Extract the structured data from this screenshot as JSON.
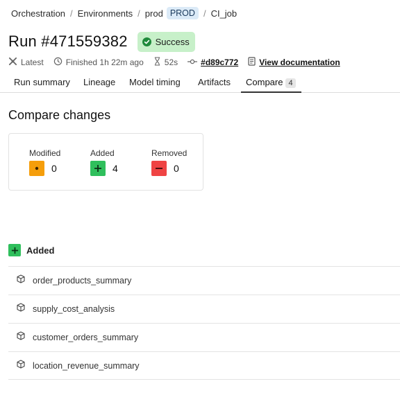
{
  "breadcrumb": {
    "items": [
      "Orchestration",
      "Environments",
      "prod"
    ],
    "env_badge": "PROD",
    "job": "CI_job",
    "separator": "/"
  },
  "header": {
    "title": "Run #471559382",
    "status": "Success",
    "status_color": "#c7f0c9"
  },
  "meta": {
    "latest": "Latest",
    "finished": "Finished 1h 22m ago",
    "duration": "52s",
    "commit": "#d89c772",
    "docs": "View documentation"
  },
  "tabs": [
    {
      "label": "Run summary"
    },
    {
      "label": "Lineage"
    },
    {
      "label": "Model timing"
    },
    {
      "label": "Artifacts"
    },
    {
      "label": "Compare",
      "count": "4",
      "active": true
    }
  ],
  "compare": {
    "title": "Compare changes",
    "modified_label": "Modified",
    "modified_value": "0",
    "modified_color": "#f59e0b",
    "added_label": "Added",
    "added_value": "4",
    "added_color": "#2fbf5c",
    "removed_label": "Removed",
    "removed_value": "0",
    "removed_color": "#ef4444"
  },
  "added_section": {
    "title": "Added",
    "models": [
      "order_products_summary",
      "supply_cost_analysis",
      "customer_orders_summary",
      "location_revenue_summary"
    ]
  }
}
